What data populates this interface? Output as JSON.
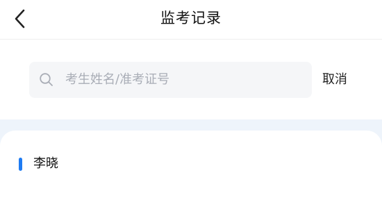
{
  "header": {
    "title": "监考记录",
    "back_icon": "chevron-left-icon"
  },
  "search": {
    "placeholder": "考生姓名/准考证号",
    "icon": "search-icon",
    "cancel_label": "取消"
  },
  "records": [
    {
      "name": "李晓"
    }
  ],
  "colors": {
    "accent": "#1f7bf2",
    "list_background": "#eef4fb",
    "search_background": "#f5f6f8",
    "placeholder_text": "#a9adb6"
  }
}
